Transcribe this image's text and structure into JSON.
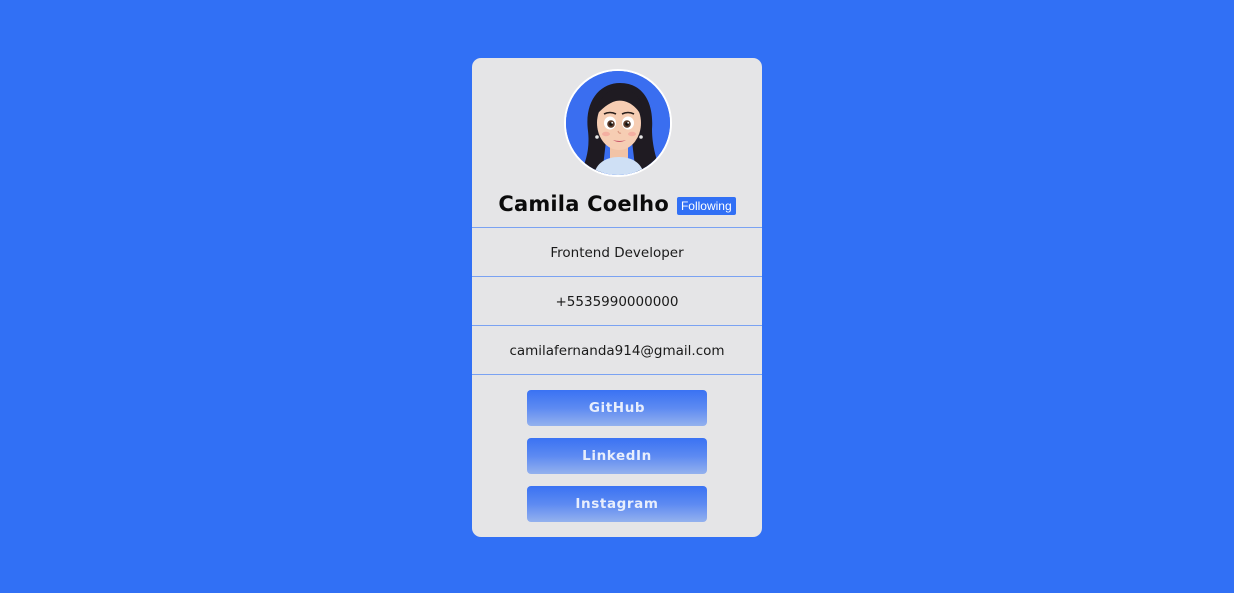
{
  "profile": {
    "name": "Camila Coelho",
    "follow_badge": "Following",
    "avatar_icon": "avatar-illustration"
  },
  "info": {
    "role": "Frontend Developer",
    "phone": "+5535990000000",
    "email": "camilafernanda914@gmail.com"
  },
  "links": {
    "github": "GitHub",
    "linkedin": "LinkedIn",
    "instagram": "Instagram"
  },
  "colors": {
    "page_background": "#3170f5",
    "card_background": "#e5e5e7",
    "accent": "#3170f5",
    "divider": "#7aa2f2"
  }
}
